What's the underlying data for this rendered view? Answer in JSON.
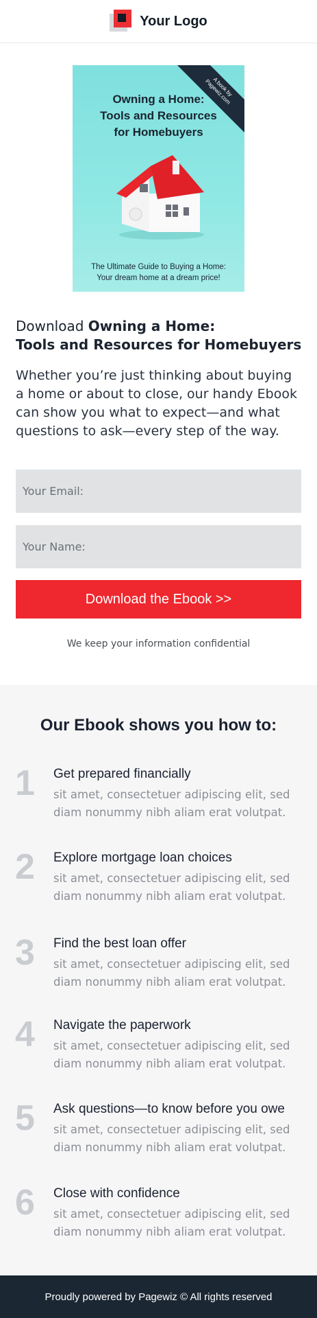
{
  "header": {
    "logo_text": "Your Logo"
  },
  "cover": {
    "title_line1": "Owning a Home:",
    "title_line2": "Tools and Resources",
    "title_line3": "for Homebuyers",
    "ribbon_line1": "A book by",
    "ribbon_line2": "Pagewiz.com",
    "sub_line1": "The Ultimate Guide to Buying a Home:",
    "sub_line2": "Your dream home at a dream price!",
    "bg_color": "#88e4e1",
    "roof_color": "#e8262b"
  },
  "hero": {
    "title_prefix": "Download ",
    "title_bold_line1": "Owning a Home:",
    "title_bold_line2": "Tools and Resources for Homebuyers",
    "description": "Whether you’re just thinking about buying a home or about to close, our handy Ebook can show you what to expect—and what questions to ask—every step of the way."
  },
  "form": {
    "email_placeholder": "Your Email:",
    "name_placeholder": "Your Name:",
    "submit_label": "Download the Ebook >>",
    "confidential_note": "We keep your information confidential",
    "accent_color": "#ef272e"
  },
  "features": {
    "title": "Our Ebook shows you how to:",
    "items": [
      {
        "number": "1",
        "title": "Get prepared financially",
        "text": "sit amet, consectetuer adipiscing elit, sed diam nonummy nibh aliam erat volutpat."
      },
      {
        "number": "2",
        "title": "Explore mortgage loan choices",
        "text": "sit amet, consectetuer adipiscing elit, sed diam nonummy nibh aliam erat volutpat."
      },
      {
        "number": "3",
        "title": "Find the best loan offer",
        "text": "sit amet, consectetuer adipiscing elit, sed diam nonummy nibh aliam erat volutpat."
      },
      {
        "number": "4",
        "title": "Navigate the paperwork",
        "text": "sit amet, consectetuer adipiscing elit, sed diam nonummy nibh aliam erat volutpat."
      },
      {
        "number": "5",
        "title": "Ask questions—to know before you owe",
        "text": "sit amet, consectetuer adipiscing elit, sed diam nonummy nibh aliam erat volutpat."
      },
      {
        "number": "6",
        "title": "Close with confidence",
        "text": "sit amet, consectetuer adipiscing elit, sed diam nonummy nibh aliam erat volutpat."
      }
    ]
  },
  "footer": {
    "text": "Proudly powered by Pagewiz © All rights reserved"
  }
}
